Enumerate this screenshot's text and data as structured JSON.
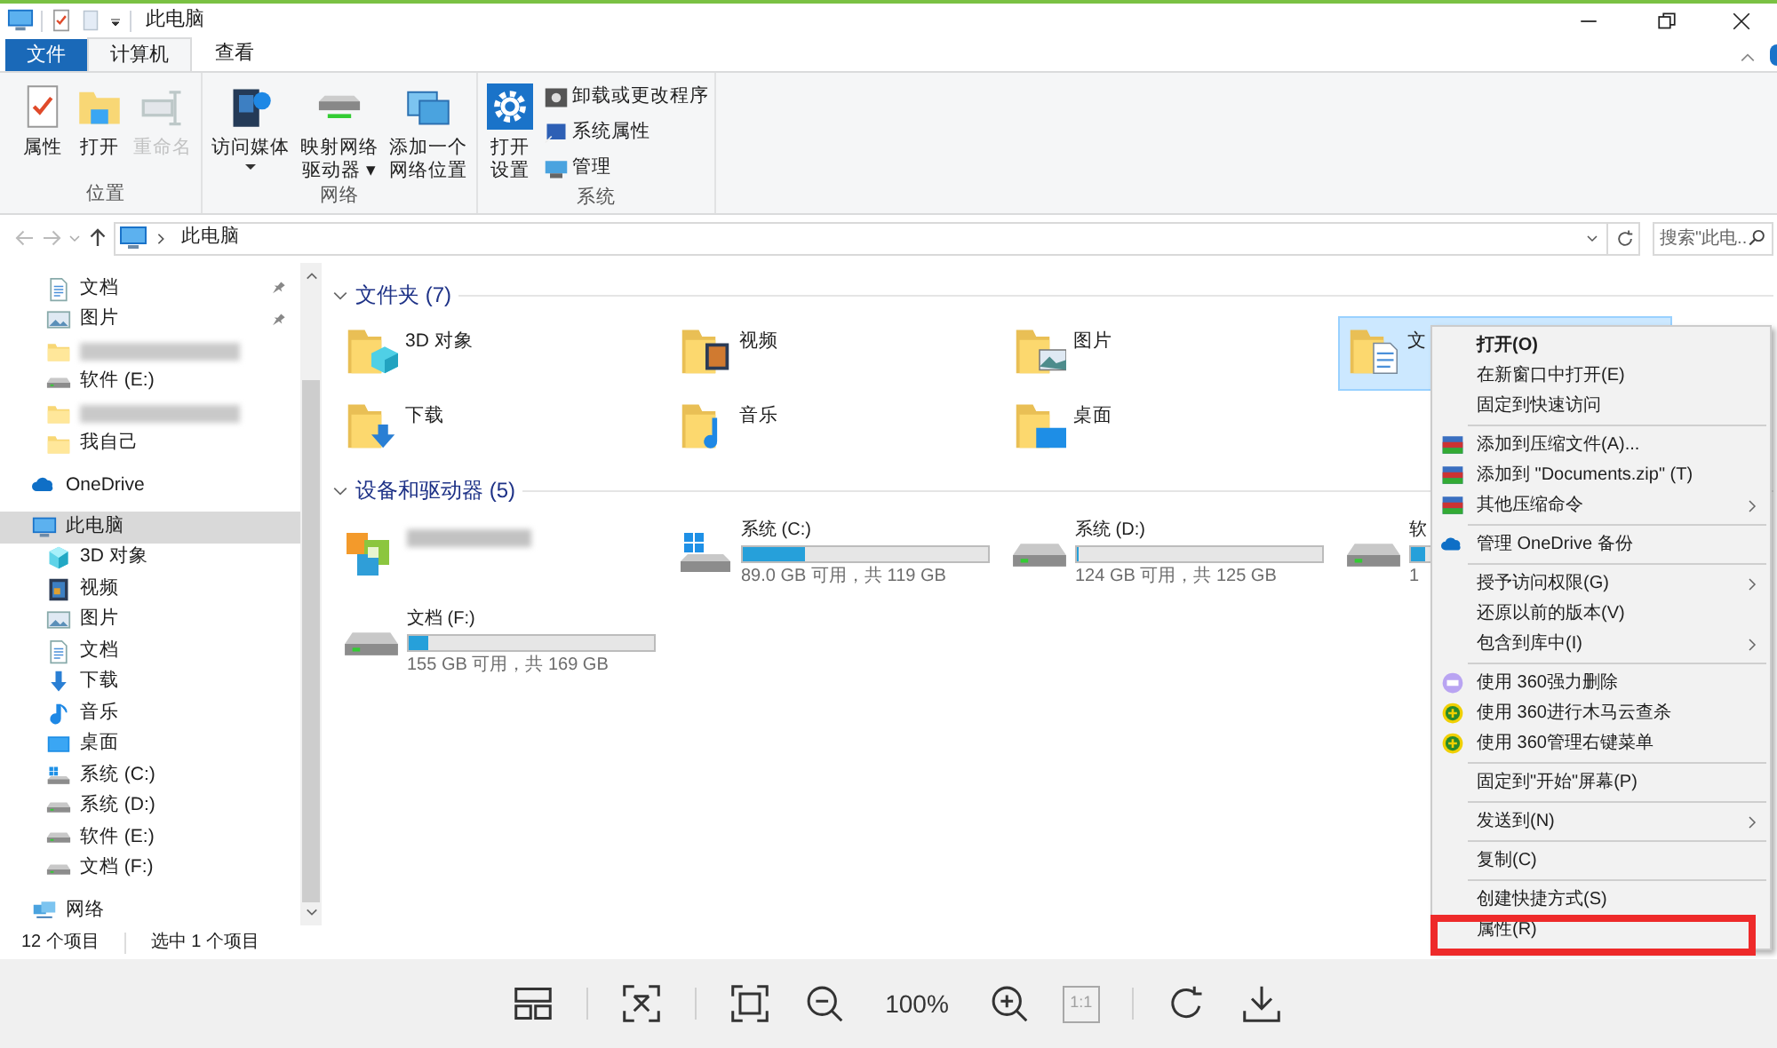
{
  "title_bar": {
    "title": "此电脑"
  },
  "ribbon": {
    "tabs": [
      {
        "label": "文件",
        "kind": "file",
        "selected": false
      },
      {
        "label": "计算机",
        "kind": "tab",
        "selected": true
      },
      {
        "label": "查看",
        "kind": "tab",
        "selected": false
      }
    ],
    "groups": [
      {
        "label": "位置",
        "buttons": [
          {
            "lines": [
              "属性"
            ],
            "disabled": false
          },
          {
            "lines": [
              "打开"
            ],
            "disabled": false
          },
          {
            "lines": [
              "重命名"
            ],
            "disabled": true
          }
        ]
      },
      {
        "label": "网络",
        "buttons": [
          {
            "lines": [
              "访问媒体"
            ],
            "dropdown": true,
            "disabled": false
          },
          {
            "lines": [
              "映射网络",
              "驱动器 ▾"
            ],
            "disabled": false
          },
          {
            "lines": [
              "添加一个",
              "网络位置"
            ],
            "disabled": false
          }
        ]
      },
      {
        "label": "系统",
        "buttons": [
          {
            "lines": [
              "打开",
              "设置"
            ],
            "disabled": false
          }
        ],
        "small_buttons": [
          "卸载或更改程序",
          "系统属性",
          "管理"
        ]
      }
    ]
  },
  "address_bar": {
    "path": "此电脑",
    "search_placeholder": "搜索\"此电..."
  },
  "nav": {
    "quick_access": [
      {
        "kind": "doc",
        "label": "文档",
        "pinned": true
      },
      {
        "kind": "pictures",
        "label": "图片",
        "pinned": true
      },
      {
        "kind": "folder",
        "redacted": true,
        "pinned": false
      },
      {
        "kind": "drive",
        "label": "软件 (E:)",
        "pinned": false
      },
      {
        "kind": "folder",
        "redacted": true,
        "pinned": false
      },
      {
        "kind": "folder",
        "label": "我自己",
        "pinned": false
      }
    ],
    "roots": [
      {
        "kind": "onedrive",
        "label": "OneDrive",
        "selected": false
      },
      {
        "kind": "pc",
        "label": "此电脑",
        "selected": true,
        "children": [
          {
            "kind": "objects",
            "label": "3D 对象"
          },
          {
            "kind": "video",
            "label": "视频"
          },
          {
            "kind": "pictures",
            "label": "图片"
          },
          {
            "kind": "doc",
            "label": "文档"
          },
          {
            "kind": "download",
            "label": "下载"
          },
          {
            "kind": "music",
            "label": "音乐"
          },
          {
            "kind": "desktop",
            "label": "桌面"
          },
          {
            "kind": "windrive",
            "label": "系统 (C:)"
          },
          {
            "kind": "drive",
            "label": "系统 (D:)"
          },
          {
            "kind": "drive",
            "label": "软件 (E:)"
          },
          {
            "kind": "drive",
            "label": "文档 (F:)"
          }
        ]
      },
      {
        "kind": "network",
        "label": "网络",
        "selected": false
      }
    ]
  },
  "folders": {
    "title": "文件夹 (7)",
    "items": [
      {
        "kind": "objects",
        "label": "3D 对象",
        "selected": false
      },
      {
        "kind": "video",
        "label": "视频",
        "selected": false
      },
      {
        "kind": "pictures",
        "label": "图片",
        "selected": false
      },
      {
        "kind": "doc",
        "label": "文",
        "selected": true
      },
      {
        "kind": "download",
        "label": "下载",
        "selected": false
      },
      {
        "kind": "music",
        "label": "音乐",
        "selected": false
      },
      {
        "kind": "desktop",
        "label": "桌面",
        "selected": false
      }
    ]
  },
  "drives": {
    "title": "设备和驱动器 (5)",
    "items": [
      {
        "kind": "media",
        "redacted": true
      },
      {
        "kind": "windrive",
        "label": "系统 (C:)",
        "level": 0.25,
        "caption": "89.0 GB 可用，共 119 GB"
      },
      {
        "kind": "drive",
        "label": "系统 (D:)",
        "level": 0.01,
        "caption": "124 GB 可用，共 125 GB"
      },
      {
        "kind": "drive",
        "label": "软",
        "level": 0.06,
        "caption": "1"
      },
      {
        "kind": "drive",
        "label": "文档 (F:)",
        "level": 0.08,
        "caption": "155 GB 可用，共 169 GB"
      }
    ]
  },
  "status_bar": [
    "12 个项目",
    "选中 1 个项目"
  ],
  "context_menu": [
    {
      "kind": "item",
      "label": "打开(O)",
      "default": true
    },
    {
      "kind": "item",
      "label": "在新窗口中打开(E)"
    },
    {
      "kind": "item",
      "label": "固定到快速访问"
    },
    {
      "kind": "separator"
    },
    {
      "kind": "item",
      "label": "添加到压缩文件(A)..."
    },
    {
      "kind": "item",
      "label": "添加到 \"Documents.zip\" (T)"
    },
    {
      "kind": "item",
      "label": "其他压缩命令",
      "submenu": true
    },
    {
      "kind": "separator"
    },
    {
      "kind": "item",
      "label": "管理 OneDrive 备份"
    },
    {
      "kind": "separator"
    },
    {
      "kind": "item",
      "label": "授予访问权限(G)",
      "submenu": true
    },
    {
      "kind": "item",
      "label": "还原以前的版本(V)"
    },
    {
      "kind": "item",
      "label": "包含到库中(I)",
      "submenu": true
    },
    {
      "kind": "separator"
    },
    {
      "kind": "item",
      "label": "使用 360强力删除"
    },
    {
      "kind": "item",
      "label": "使用 360进行木马云查杀"
    },
    {
      "kind": "item",
      "label": "使用 360管理右键菜单"
    },
    {
      "kind": "separator"
    },
    {
      "kind": "item",
      "label": "固定到\"开始\"屏幕(P)"
    },
    {
      "kind": "separator"
    },
    {
      "kind": "item",
      "label": "发送到(N)",
      "submenu": true
    },
    {
      "kind": "separator"
    },
    {
      "kind": "item",
      "label": "复制(C)"
    },
    {
      "kind": "separator"
    },
    {
      "kind": "item",
      "label": "创建快捷方式(S)"
    },
    {
      "kind": "item",
      "label": "属性(R)"
    }
  ],
  "viewer_toolbar": {
    "zoom": "100%",
    "actual_size": "1:1"
  }
}
